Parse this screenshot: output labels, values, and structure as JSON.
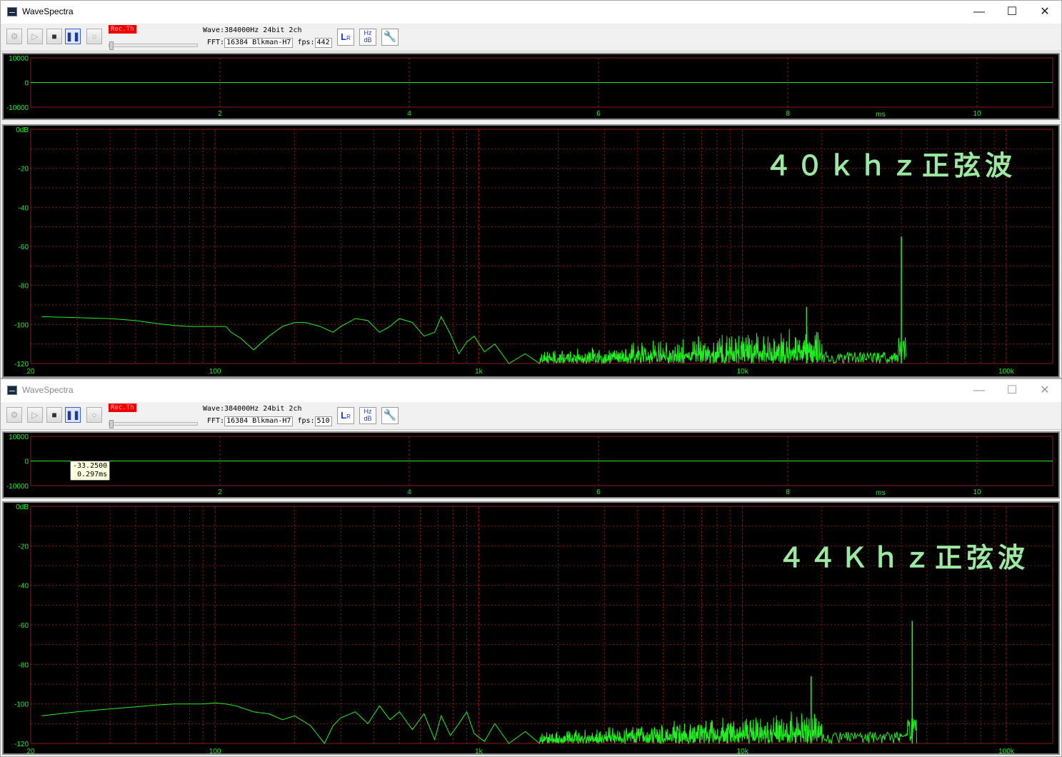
{
  "windows": [
    {
      "id": "win1",
      "title": "WaveSpectra",
      "active": true,
      "rec_badge": "Rec.Th",
      "wave_label": "Wave:",
      "wave_value": "384000Hz 24bit 2ch",
      "fft_label": "FFT:",
      "fft_value": "16384 Blkman-H7",
      "fps_label": "fps:",
      "fps_value": "442",
      "annotation": "４０ｋｈｚ正弦波",
      "peak": {
        "freq": 40000,
        "db": -55
      },
      "tooltip": null
    },
    {
      "id": "win2",
      "title": "WaveSpectra",
      "active": false,
      "rec_badge": "Rec.Th",
      "wave_label": "Wave:",
      "wave_value": "384000Hz 24bit 2ch",
      "fft_label": "FFT:",
      "fft_value": "16384 Blkman-H7",
      "fps_label": "fps:",
      "fps_value": "510",
      "annotation": "４４Ｋｈｚ正弦波",
      "peak": {
        "freq": 44000,
        "db": -58
      },
      "tooltip": {
        "line1": "-33.2500",
        "line2": "0.297ms"
      }
    }
  ],
  "icons": {
    "settings": "settings-plug-icon",
    "play": "play-icon",
    "stop": "stop-icon",
    "pause": "pause-icon",
    "record": "record-icon",
    "channel": "lr-channel-icon",
    "scale": "hz-db-scale-icon",
    "tools": "wrench-icon"
  },
  "colors": {
    "trace": "#22ee22",
    "grid": "#8a1a1a",
    "axis_text": "#22ee22",
    "annotation": "#9be8a0",
    "rec_badge": "#ee0000"
  },
  "chart_data": [
    {
      "type": "line",
      "title": "",
      "xlabel": "ms",
      "ylabel": "",
      "xlim": [
        0,
        10.8
      ],
      "ylim": [
        -10000,
        10000
      ],
      "x_ticks": [
        "2",
        "4",
        "6",
        "8",
        "10"
      ],
      "y_ticks": [
        "10000",
        "0",
        "-10000"
      ],
      "x_unit_label": "ms",
      "series": [
        {
          "x": [
            0,
            10.8
          ],
          "values": [
            0,
            0
          ]
        }
      ]
    },
    {
      "type": "line",
      "xlim": [
        20,
        150000
      ],
      "xscale": "log",
      "ylim": [
        -120,
        0
      ],
      "x_ticks": [
        "20",
        "100",
        "1k",
        "10k",
        "100k"
      ],
      "y_ticks": [
        "0dB",
        "-20",
        "-40",
        "-60",
        "-80",
        "-100",
        "-120"
      ],
      "series": [
        {
          "x": [
            22,
            30,
            40,
            50,
            60,
            70,
            80,
            90,
            100,
            110,
            115,
            125,
            140,
            160,
            180,
            200,
            220,
            250,
            280,
            300,
            340,
            380,
            420,
            460,
            500,
            560,
            620,
            680,
            720,
            780,
            840,
            900,
            960,
            1050,
            1150,
            1300,
            1500,
            1700
          ],
          "values": [
            -96,
            -96.5,
            -97,
            -98,
            -99.5,
            -100.5,
            -101,
            -101,
            -101,
            -101,
            -104,
            -107,
            -113,
            -106,
            -101,
            -99,
            -99,
            -101,
            -104,
            -101,
            -97,
            -98,
            -104,
            -101,
            -97,
            -99,
            -106,
            -104,
            -96,
            -105,
            -115,
            -109,
            -106,
            -114,
            -110,
            -120,
            -115,
            -120
          ]
        }
      ],
      "noise_band": {
        "from_hz": 1700,
        "to_hz": 20000,
        "floor_db": -120,
        "top_db": -100
      },
      "spikes": [
        {
          "freq": 17500,
          "db": -91
        },
        {
          "freq": 40000,
          "db": -55
        }
      ]
    },
    {
      "type": "line",
      "xlim": [
        0,
        10.8
      ],
      "ylim": [
        -10000,
        10000
      ],
      "x_ticks": [
        "2",
        "4",
        "6",
        "8",
        "10"
      ],
      "y_ticks": [
        "10000",
        "0",
        "-10000"
      ],
      "x_unit_label": "ms",
      "series": [
        {
          "x": [
            0,
            10.8
          ],
          "values": [
            0,
            0
          ]
        }
      ]
    },
    {
      "type": "line",
      "xlim": [
        20,
        150000
      ],
      "xscale": "log",
      "ylim": [
        -120,
        0
      ],
      "x_ticks": [
        "20",
        "100",
        "1k",
        "10k",
        "100k"
      ],
      "y_ticks": [
        "0dB",
        "-20",
        "-40",
        "-60",
        "-80",
        "-100",
        "-120"
      ],
      "series": [
        {
          "x": [
            22,
            30,
            40,
            50,
            60,
            70,
            80,
            90,
            100,
            110,
            120,
            140,
            160,
            180,
            200,
            230,
            260,
            280,
            300,
            340,
            380,
            420,
            460,
            500,
            560,
            620,
            680,
            720,
            780,
            840,
            900,
            960,
            1050,
            1150,
            1300,
            1500,
            1700
          ],
          "values": [
            -106,
            -104,
            -102.5,
            -101.5,
            -100.5,
            -100,
            -100,
            -100,
            -99.5,
            -100,
            -101,
            -104,
            -105,
            -108,
            -106,
            -111,
            -120,
            -111,
            -107,
            -104,
            -110,
            -101,
            -108,
            -104,
            -113,
            -105,
            -118,
            -106,
            -116,
            -110,
            -104,
            -115,
            -119,
            -110,
            -120,
            -114,
            -120
          ]
        }
      ],
      "noise_band": {
        "from_hz": 1700,
        "to_hz": 20000,
        "floor_db": -120,
        "top_db": -102
      },
      "spikes": [
        {
          "freq": 18200,
          "db": -86
        },
        {
          "freq": 44000,
          "db": -58
        }
      ]
    }
  ]
}
